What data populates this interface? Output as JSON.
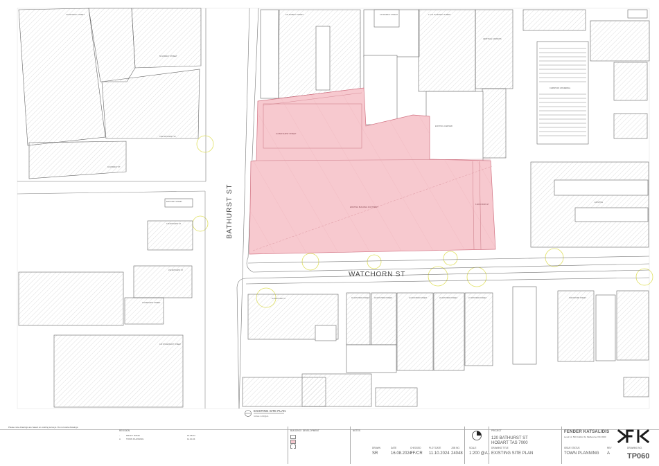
{
  "plan": {
    "streets": {
      "bathurst": "BATHURST ST",
      "watchorn": "WATCHORN ST"
    },
    "title_caption": "EXISTING SITE PLAN",
    "scale_caption": "SCALE 1:200@A1",
    "site_label": "EXISTING BUILDING FOOTPRINT",
    "site_hatch_color": "#f7c9cf",
    "labels": {
      "cathedral": "CHRISTIAN CATHEDRAL",
      "gardens": "HERITAGE GARDENS",
      "car_park": "EXISTING CARPARK",
      "block_north": "116 BATHURST STREET",
      "block_south": "110 BATHURST STREET",
      "block_ne": "6 WATCHORN ST",
      "block_east": "EXISTING",
      "house_a": "112 BATHURST ST",
      "house_b": "106 BATHURST ST",
      "lot_a": "39 WATCHORN STREET",
      "lot_b": "36 WATCHORN STREET",
      "lot_c": "24 WATCHORN STREET",
      "lot_d": "29 WATCHORN STREET",
      "lot_e": "27 WATCHORN STREET",
      "lot_f": "5 WATCHORN STREET",
      "sw1": "BATHURST STREET",
      "sw2": "STONEHURST STREET",
      "sw3": "135 STONEHURST STREET",
      "top1": "123 MURRAY STREET",
      "top2": "135 MURRAY STREET",
      "top3": "1-11 & 15 MURRAY STREET"
    }
  },
  "title_block": {
    "disclaimer": "Please note drawings are based on existing surveys. Do not scale drawings.",
    "revision_header": "REVISION",
    "revisions": [
      {
        "rev": "-",
        "desc": "DRAFT ISSUE",
        "date": "16.08.24"
      },
      {
        "rev": "A",
        "desc": "TOWN PLANNING",
        "date": "11.10.24"
      }
    ],
    "legend_header": "BUILDING / DEVELOPMENT",
    "notes_header": "NOTES",
    "fields": {
      "drawn_label": "DRAWN",
      "drawn": "SR",
      "date_label": "DATE",
      "date": "16.08.2024",
      "checked_label": "CHECKED",
      "checked": "FF/CR",
      "plot_label": "PLOT DATE",
      "plot": "11.10.2024",
      "job_label": "JOB NO.",
      "job": "24048",
      "scale_label": "SCALE",
      "scale": "1:200 @A1",
      "project_label": "PROJECT",
      "project_line1": "120 BATHURST ST",
      "project_line2": "HOBART TAS 7000",
      "drawing_title_label": "DRAWING TITLE",
      "drawing_title": "EXISTING SITE PLAN",
      "issue_label": "ISSUE STATUS",
      "issue": "TOWN PLANNING",
      "rev_label": "REV",
      "rev": "A",
      "drawing_no_label": "DRAWING NO.",
      "drawing_no": "TP060"
    },
    "firm": {
      "name": "FENDER KATSALIDIS",
      "address": "Level 11, 530 Collins St, Melbourne VIC 3000",
      "logo_text": "FK"
    }
  }
}
